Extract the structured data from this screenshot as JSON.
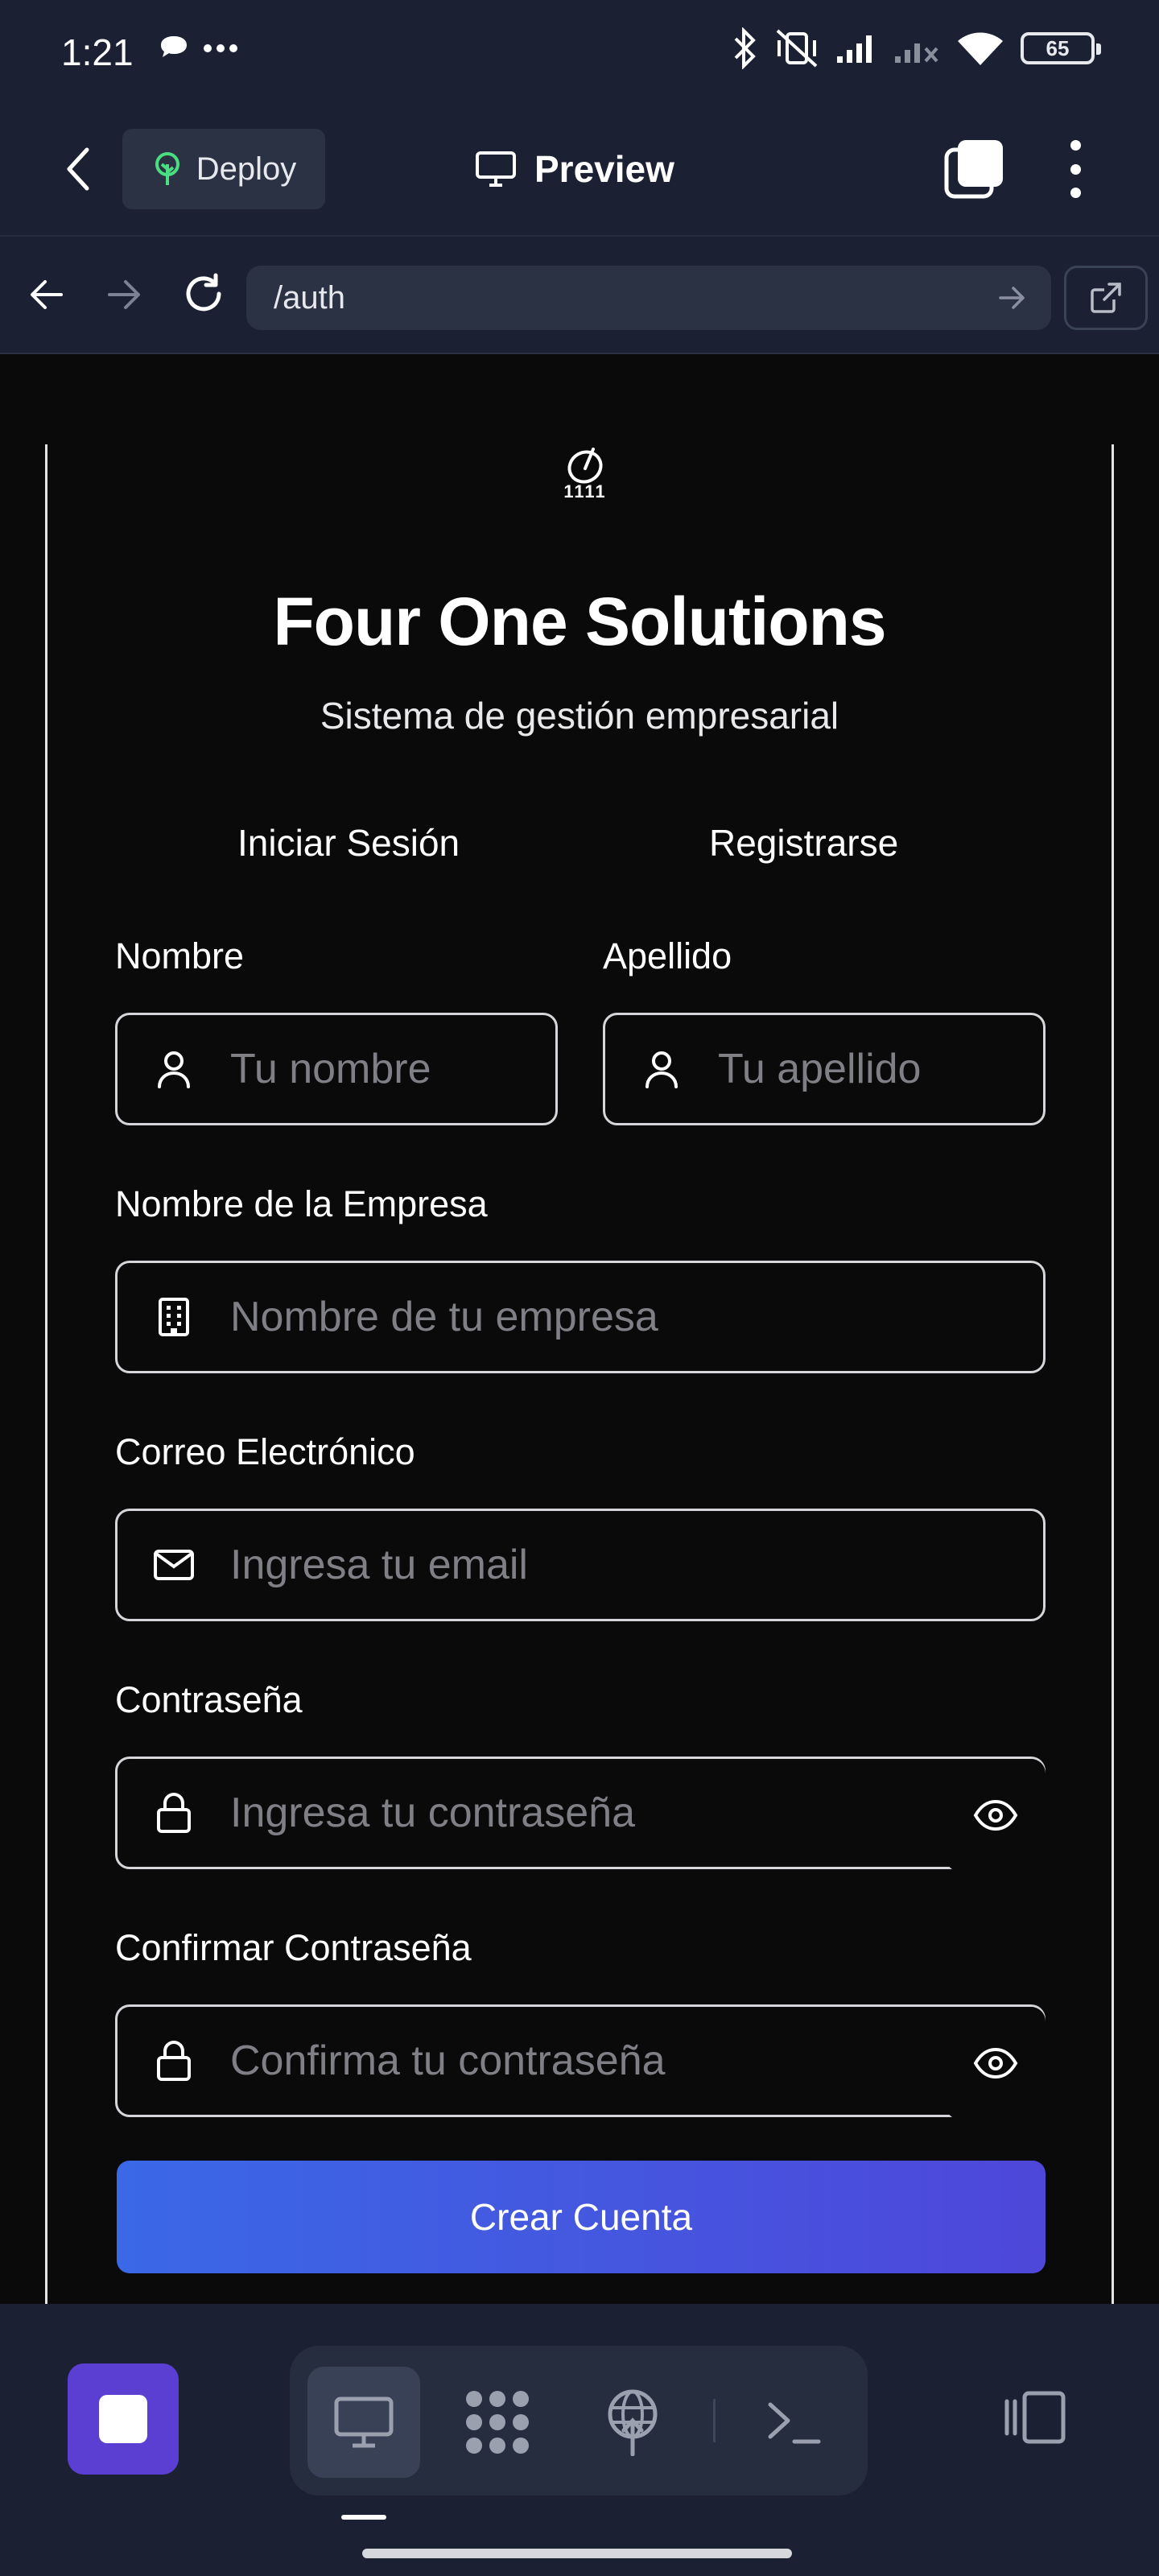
{
  "status_bar": {
    "time": "1:21",
    "battery": "65"
  },
  "app_header": {
    "deploy_label": "Deploy",
    "preview_label": "Preview"
  },
  "url_bar": {
    "url": "/auth"
  },
  "auth": {
    "brand_logo_text": "1111",
    "title": "Four One Solutions",
    "subtitle": "Sistema de gestión empresarial",
    "tabs": [
      "Iniciar Sesión",
      "Registrarse"
    ],
    "fields": {
      "first_name": {
        "label": "Nombre",
        "placeholder": "Tu nombre",
        "value": ""
      },
      "last_name": {
        "label": "Apellido",
        "placeholder": "Tu apellido",
        "value": ""
      },
      "company": {
        "label": "Nombre de la Empresa",
        "placeholder": "Nombre de tu empresa",
        "value": ""
      },
      "email": {
        "label": "Correo Electrónico",
        "placeholder": "Ingresa tu email",
        "value": ""
      },
      "password": {
        "label": "Contraseña",
        "placeholder": "Ingresa tu contraseña",
        "value": ""
      },
      "confirm_password": {
        "label": "Confirmar Contraseña",
        "placeholder": "Confirma tu contraseña",
        "value": ""
      }
    },
    "submit_label": "Crear Cuenta"
  },
  "colors": {
    "chrome_bg": "#1b2133",
    "page_bg": "#0a0a0b",
    "button_gradient_start": "#3a68e6",
    "button_gradient_end": "#4e47d9",
    "stop_button": "#5b3fd3"
  },
  "icons": {
    "status": [
      "chat-bubble-icon",
      "more-dots-icon",
      "bluetooth-icon",
      "vibrate-off-icon",
      "signal-icon",
      "signal-off-icon",
      "wifi-icon",
      "battery-icon"
    ],
    "toolbar": [
      "stop-icon",
      "desktop-icon",
      "dots-grid-icon",
      "globe-upload-icon",
      "terminal-icon",
      "side-panel-icon"
    ]
  }
}
